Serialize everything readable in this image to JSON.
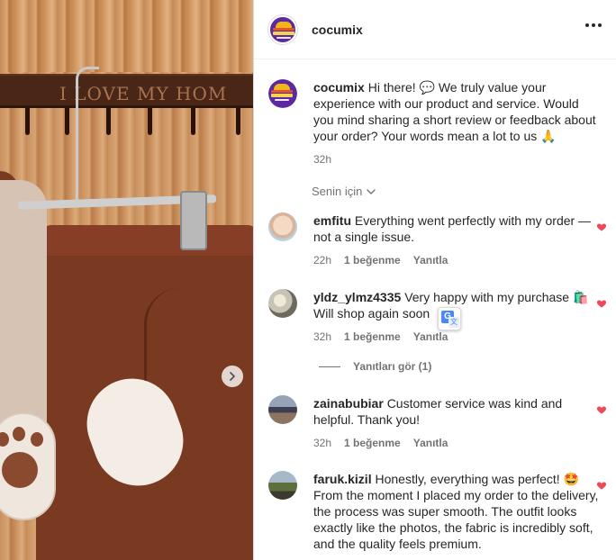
{
  "photo": {
    "rack_text": "I LOVE MY HOM",
    "next_label": "Next"
  },
  "header": {
    "username": "cocumix"
  },
  "caption": {
    "username": "cocumix",
    "text": "Hi there! 💬 We truly value your experience with our product and service. Would you mind sharing a short review or feedback about your order? Your words mean a lot to us 🙏",
    "time": "32h"
  },
  "filter": {
    "label": "Senin için"
  },
  "comments": [
    {
      "username": "emfitu",
      "text": "Everything went perfectly with my order — not a single issue.",
      "time": "22h",
      "likes": "1 beğenme",
      "reply": "Yanıtla"
    },
    {
      "username": "yldz_ylmz4335",
      "text": "Very happy with my purchase 🛍️ Will shop again soon",
      "time": "32h",
      "likes": "1 beğenme",
      "reply": "Yanıtla"
    },
    {
      "username": "zainabubiar",
      "text": "Customer service was kind and helpful. Thank you!",
      "time": "32h",
      "likes": "1 beğenme",
      "reply": "Yanıtla"
    },
    {
      "username": "faruk.kizil",
      "text": "Honestly, everything was perfect! 🤩 From the moment I placed my order to the delivery, the process was super smooth. The outfit looks exactly like the photos, the fabric is incredibly soft, and the quality feels premium."
    }
  ],
  "view_replies": {
    "label": "Yanıtları gör (1)"
  },
  "translate": {
    "g": "G",
    "x": "文"
  },
  "colors": {
    "heart": "#ed4956",
    "muted_text": "#737373",
    "brand_avatar": "#5b2aa0"
  }
}
